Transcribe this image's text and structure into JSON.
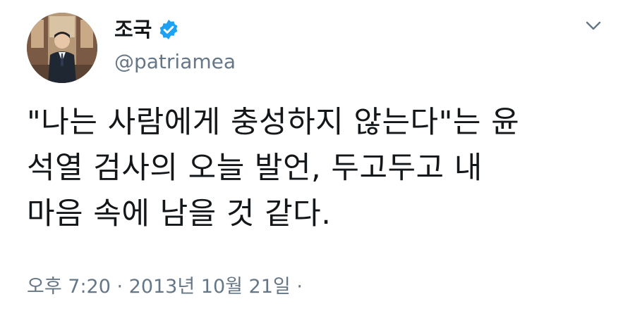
{
  "user": {
    "display_name": "조국",
    "handle": "@patriamea",
    "verified_icon": "verified-badge-icon",
    "avatar_icon": "profile-photo"
  },
  "tweet": {
    "text": "\"나는 사람에게 충성하지 않는다\"는 윤\n석열 검사의 오늘 발언, 두고두고 내\n마음 속에 남을 것 같다.",
    "timestamp": "오후 7:20 · 2013년 10월 21일 ·"
  },
  "menu": {
    "icon": "chevron-down-icon"
  },
  "colors": {
    "verified_blue": "#1da1f2",
    "secondary_text": "#657786",
    "primary_text": "#14171a"
  }
}
